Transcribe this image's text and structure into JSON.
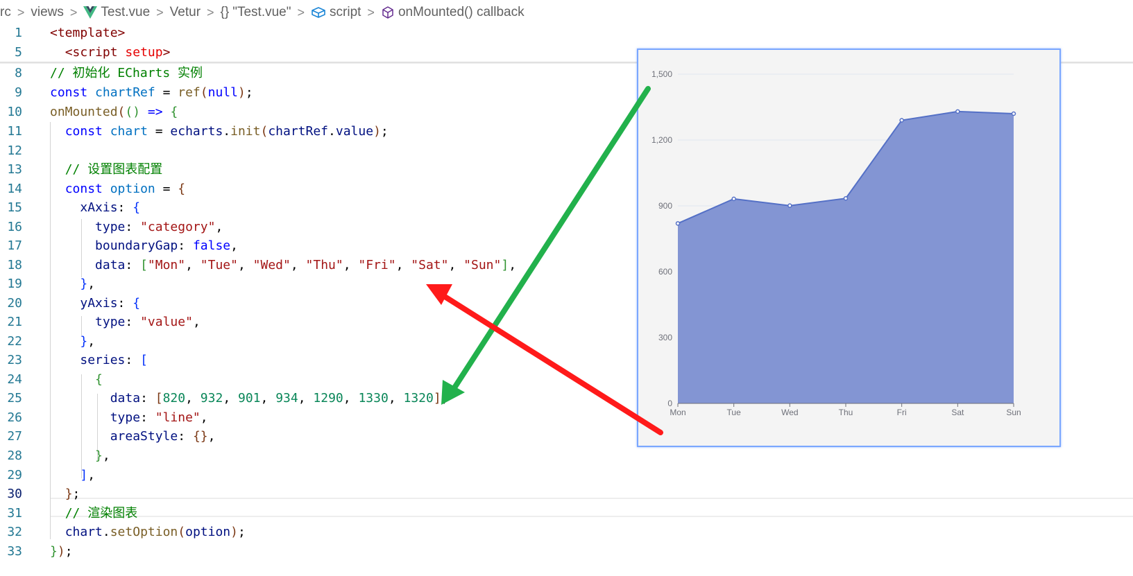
{
  "breadcrumb": {
    "items": [
      "rc",
      "views",
      "Test.vue",
      "Vetur",
      "\"Test.vue\"",
      "script",
      "onMounted() callback"
    ],
    "braces": "{}"
  },
  "editor": {
    "lines": [
      {
        "n": "1",
        "tokens": [
          [
            "c-tag",
            "<template>"
          ]
        ]
      },
      {
        "n": "5",
        "tokens": [
          [
            "c-p",
            "  "
          ],
          [
            "c-tag",
            "<script "
          ],
          [
            "c-attr",
            "setup"
          ],
          [
            "c-tag",
            ">"
          ]
        ]
      },
      {
        "n": "8",
        "tokens": [
          [
            "c-cmt",
            "// 初始化 ECharts 实例"
          ]
        ]
      },
      {
        "n": "9",
        "tokens": [
          [
            "c-kw",
            "const "
          ],
          [
            "c-var",
            "chartRef"
          ],
          [
            "c-p",
            " = "
          ],
          [
            "c-fn",
            "ref"
          ],
          [
            "c-b3",
            "("
          ],
          [
            "c-kw",
            "null"
          ],
          [
            "c-b3",
            ")"
          ],
          [
            "c-p",
            ";"
          ]
        ]
      },
      {
        "n": "10",
        "tokens": [
          [
            "c-fn",
            "onMounted"
          ],
          [
            "c-b3",
            "("
          ],
          [
            "c-b2",
            "("
          ],
          [
            "c-b2",
            ")"
          ],
          [
            "c-kw",
            " => "
          ],
          [
            "c-b2",
            "{"
          ]
        ]
      },
      {
        "n": "11",
        "tokens": [
          [
            "c-p",
            "  "
          ],
          [
            "c-kw",
            "const "
          ],
          [
            "c-var",
            "chart"
          ],
          [
            "c-p",
            " = "
          ],
          [
            "c-prop",
            "echarts"
          ],
          [
            "c-p",
            "."
          ],
          [
            "c-fn",
            "init"
          ],
          [
            "c-b3",
            "("
          ],
          [
            "c-prop",
            "chartRef"
          ],
          [
            "c-p",
            "."
          ],
          [
            "c-prop",
            "value"
          ],
          [
            "c-b3",
            ")"
          ],
          [
            "c-p",
            ";"
          ]
        ]
      },
      {
        "n": "12",
        "tokens": []
      },
      {
        "n": "13",
        "tokens": [
          [
            "c-p",
            "  "
          ],
          [
            "c-cmt",
            "// 设置图表配置"
          ]
        ]
      },
      {
        "n": "14",
        "tokens": [
          [
            "c-p",
            "  "
          ],
          [
            "c-kw",
            "const "
          ],
          [
            "c-var",
            "option"
          ],
          [
            "c-p",
            " = "
          ],
          [
            "c-b3",
            "{"
          ]
        ]
      },
      {
        "n": "15",
        "tokens": [
          [
            "c-p",
            "    "
          ],
          [
            "c-prop",
            "xAxis"
          ],
          [
            "c-p",
            ": "
          ],
          [
            "c-b1",
            "{"
          ]
        ]
      },
      {
        "n": "16",
        "tokens": [
          [
            "c-p",
            "      "
          ],
          [
            "c-prop",
            "type"
          ],
          [
            "c-p",
            ": "
          ],
          [
            "c-str",
            "\"category\""
          ],
          [
            "c-p",
            ","
          ]
        ]
      },
      {
        "n": "17",
        "tokens": [
          [
            "c-p",
            "      "
          ],
          [
            "c-prop",
            "boundaryGap"
          ],
          [
            "c-p",
            ": "
          ],
          [
            "c-kw",
            "false"
          ],
          [
            "c-p",
            ","
          ]
        ]
      },
      {
        "n": "18",
        "tokens": [
          [
            "c-p",
            "      "
          ],
          [
            "c-prop",
            "data"
          ],
          [
            "c-p",
            ": "
          ],
          [
            "c-b2",
            "["
          ],
          [
            "c-str",
            "\"Mon\""
          ],
          [
            "c-p",
            ", "
          ],
          [
            "c-str",
            "\"Tue\""
          ],
          [
            "c-p",
            ", "
          ],
          [
            "c-str",
            "\"Wed\""
          ],
          [
            "c-p",
            ", "
          ],
          [
            "c-str",
            "\"Thu\""
          ],
          [
            "c-p",
            ", "
          ],
          [
            "c-str",
            "\"Fri\""
          ],
          [
            "c-p",
            ", "
          ],
          [
            "c-str",
            "\"Sat\""
          ],
          [
            "c-p",
            ", "
          ],
          [
            "c-str",
            "\"Sun\""
          ],
          [
            "c-b2",
            "]"
          ],
          [
            "c-p",
            ","
          ]
        ]
      },
      {
        "n": "19",
        "tokens": [
          [
            "c-p",
            "    "
          ],
          [
            "c-b1",
            "}"
          ],
          [
            "c-p",
            ","
          ]
        ]
      },
      {
        "n": "20",
        "tokens": [
          [
            "c-p",
            "    "
          ],
          [
            "c-prop",
            "yAxis"
          ],
          [
            "c-p",
            ": "
          ],
          [
            "c-b1",
            "{"
          ]
        ]
      },
      {
        "n": "21",
        "tokens": [
          [
            "c-p",
            "      "
          ],
          [
            "c-prop",
            "type"
          ],
          [
            "c-p",
            ": "
          ],
          [
            "c-str",
            "\"value\""
          ],
          [
            "c-p",
            ","
          ]
        ]
      },
      {
        "n": "22",
        "tokens": [
          [
            "c-p",
            "    "
          ],
          [
            "c-b1",
            "}"
          ],
          [
            "c-p",
            ","
          ]
        ]
      },
      {
        "n": "23",
        "tokens": [
          [
            "c-p",
            "    "
          ],
          [
            "c-prop",
            "series"
          ],
          [
            "c-p",
            ": "
          ],
          [
            "c-b1",
            "["
          ]
        ]
      },
      {
        "n": "24",
        "tokens": [
          [
            "c-p",
            "      "
          ],
          [
            "c-b2",
            "{"
          ]
        ]
      },
      {
        "n": "25",
        "tokens": [
          [
            "c-p",
            "        "
          ],
          [
            "c-prop",
            "data"
          ],
          [
            "c-p",
            ": "
          ],
          [
            "c-b3",
            "["
          ],
          [
            "c-num",
            "820"
          ],
          [
            "c-p",
            ", "
          ],
          [
            "c-num",
            "932"
          ],
          [
            "c-p",
            ", "
          ],
          [
            "c-num",
            "901"
          ],
          [
            "c-p",
            ", "
          ],
          [
            "c-num",
            "934"
          ],
          [
            "c-p",
            ", "
          ],
          [
            "c-num",
            "1290"
          ],
          [
            "c-p",
            ", "
          ],
          [
            "c-num",
            "1330"
          ],
          [
            "c-p",
            ", "
          ],
          [
            "c-num",
            "1320"
          ],
          [
            "c-b3",
            "]"
          ],
          [
            "c-p",
            ","
          ]
        ]
      },
      {
        "n": "26",
        "tokens": [
          [
            "c-p",
            "        "
          ],
          [
            "c-prop",
            "type"
          ],
          [
            "c-p",
            ": "
          ],
          [
            "c-str",
            "\"line\""
          ],
          [
            "c-p",
            ","
          ]
        ]
      },
      {
        "n": "27",
        "tokens": [
          [
            "c-p",
            "        "
          ],
          [
            "c-prop",
            "areaStyle"
          ],
          [
            "c-p",
            ": "
          ],
          [
            "c-b3",
            "{}"
          ],
          [
            "c-p",
            ","
          ]
        ]
      },
      {
        "n": "28",
        "tokens": [
          [
            "c-p",
            "      "
          ],
          [
            "c-b2",
            "}"
          ],
          [
            "c-p",
            ","
          ]
        ]
      },
      {
        "n": "29",
        "tokens": [
          [
            "c-p",
            "    "
          ],
          [
            "c-b1",
            "]"
          ],
          [
            "c-p",
            ","
          ]
        ]
      },
      {
        "n": "30",
        "tokens": [
          [
            "c-p",
            "  "
          ],
          [
            "c-b3",
            "}"
          ],
          [
            "c-p",
            ";"
          ]
        ]
      },
      {
        "n": "31",
        "tokens": [
          [
            "c-p",
            "  "
          ],
          [
            "c-cmt",
            "// 渲染图表"
          ]
        ]
      },
      {
        "n": "32",
        "tokens": [
          [
            "c-p",
            "  "
          ],
          [
            "c-prop",
            "chart"
          ],
          [
            "c-p",
            "."
          ],
          [
            "c-fn",
            "setOption"
          ],
          [
            "c-b3",
            "("
          ],
          [
            "c-prop",
            "option"
          ],
          [
            "c-b3",
            ")"
          ],
          [
            "c-p",
            ";"
          ]
        ]
      },
      {
        "n": "33",
        "tokens": [
          [
            "c-b2",
            "}"
          ],
          [
            "c-b3",
            ")"
          ],
          [
            "c-p",
            ";"
          ]
        ]
      }
    ]
  },
  "chart_data": {
    "type": "area",
    "categories": [
      "Mon",
      "Tue",
      "Wed",
      "Thu",
      "Fri",
      "Sat",
      "Sun"
    ],
    "values": [
      820,
      932,
      901,
      934,
      1290,
      1330,
      1320
    ],
    "yticks": [
      "0",
      "300",
      "600",
      "900",
      "1,200",
      "1,500"
    ],
    "ylim": [
      0,
      1500
    ],
    "grid": true,
    "fill_color": "#8395d3",
    "line_color": "#5470c6"
  },
  "annotations": {
    "green_arrow_color": "#22b14c",
    "red_arrow_color": "#ff1a1a"
  }
}
